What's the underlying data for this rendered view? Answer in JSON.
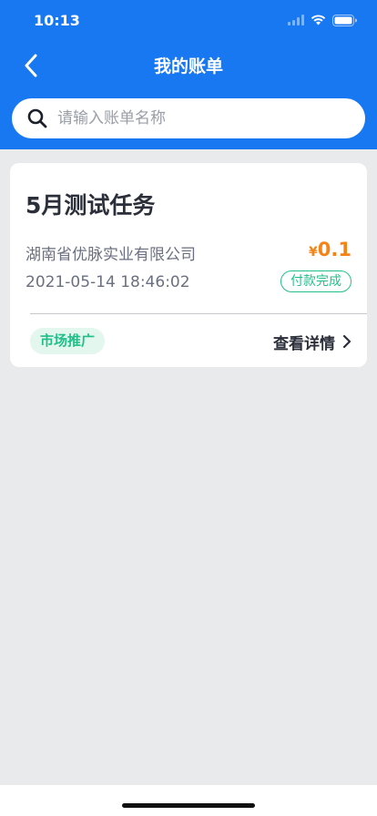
{
  "status_bar": {
    "time": "10:13"
  },
  "nav": {
    "title": "我的账单",
    "back_icon": "chevron-left-icon"
  },
  "search": {
    "placeholder": "请输入账单名称",
    "value": "",
    "icon": "search-icon"
  },
  "bill": {
    "title": "5月测试任务",
    "company": "湖南省优脉实业有限公司",
    "currency_symbol": "¥",
    "amount": "0.1",
    "datetime": "2021-05-14 18:46:02",
    "status": "付款完成",
    "category": "市场推广",
    "detail_label": "查看详情"
  },
  "colors": {
    "primary": "#1778f2",
    "amount": "#f58418",
    "success": "#22bf8a",
    "background": "#e9eaec"
  }
}
